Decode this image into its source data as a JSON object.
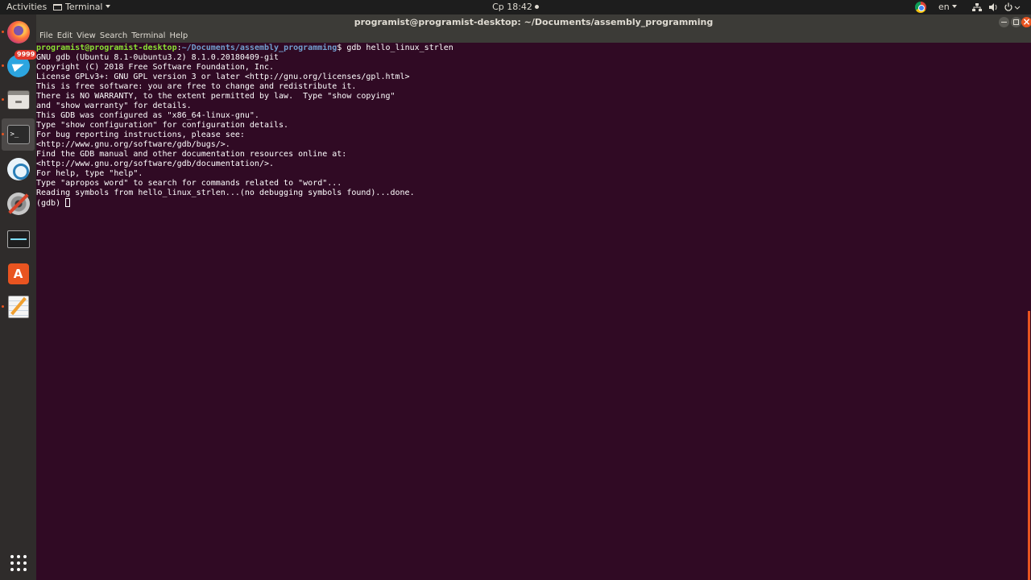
{
  "top_panel": {
    "activities": "Activities",
    "app_menu": "Terminal",
    "clock": "Ср 18:42",
    "language": "en"
  },
  "dock": {
    "telegram_badge": "9999",
    "items": [
      "firefox-icon",
      "telegram-icon",
      "files-icon",
      "terminal-icon",
      "electron-icon",
      "settings-icon",
      "monitor-icon",
      "software-icon",
      "editor-icon",
      "apps-icon"
    ],
    "terminal_glyph": ">_",
    "software_glyph": "A"
  },
  "window": {
    "title": "programist@programist-desktop: ~/Documents/assembly_programming",
    "menu": [
      "File",
      "Edit",
      "View",
      "Search",
      "Terminal",
      "Help"
    ]
  },
  "terminal": {
    "prompt_user": "programist@programist-desktop",
    "prompt_sep": ":",
    "prompt_path": "~/Documents/assembly_programming",
    "prompt_end": "$ ",
    "command": "gdb hello_linux_strlen",
    "output": [
      "GNU gdb (Ubuntu 8.1-0ubuntu3.2) 8.1.0.20180409-git",
      "Copyright (C) 2018 Free Software Foundation, Inc.",
      "License GPLv3+: GNU GPL version 3 or later <http://gnu.org/licenses/gpl.html>",
      "This is free software: you are free to change and redistribute it.",
      "There is NO WARRANTY, to the extent permitted by law.  Type \"show copying\"",
      "and \"show warranty\" for details.",
      "This GDB was configured as \"x86_64-linux-gnu\".",
      "Type \"show configuration\" for configuration details.",
      "For bug reporting instructions, please see:",
      "<http://www.gnu.org/software/gdb/bugs/>.",
      "Find the GDB manual and other documentation resources online at:",
      "<http://www.gnu.org/software/gdb/documentation/>.",
      "For help, type \"help\".",
      "Type \"apropos word\" to search for commands related to \"word\"...",
      "Reading symbols from hello_linux_strlen...(no debugging symbols found)...done."
    ],
    "gdb_prompt": "(gdb) "
  },
  "colors": {
    "terminal_bg": "#300a24",
    "accent": "#e95420",
    "prompt_user": "#8ae234",
    "prompt_path": "#729fcf"
  }
}
